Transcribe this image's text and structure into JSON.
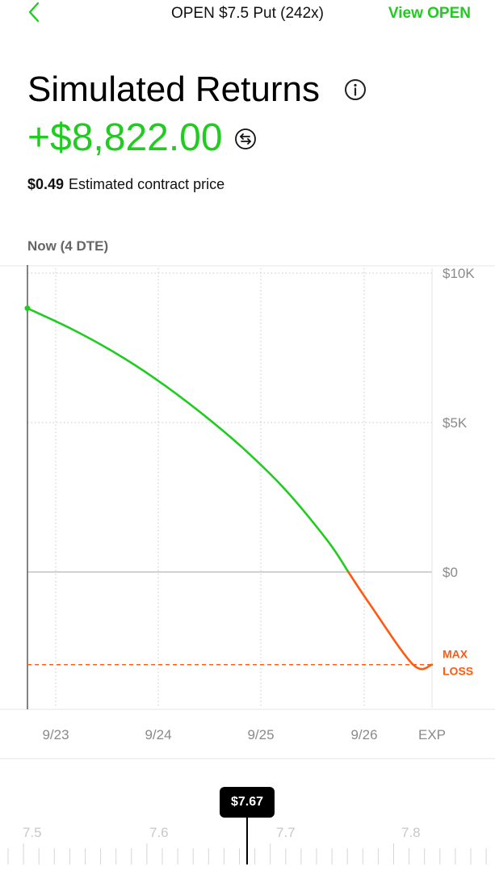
{
  "nav": {
    "title": "OPEN $7.5 Put (242x)",
    "action_label": "View OPEN",
    "accent": "#1fcc1f"
  },
  "header": {
    "title": "Simulated Returns",
    "return_value": "+$8,822.00",
    "contract_price": "$0.49",
    "contract_price_label": "Estimated contract price"
  },
  "chart_section": {
    "time_label": "Now (4 DTE)"
  },
  "chart_data": {
    "type": "line",
    "title": "",
    "xlabel": "",
    "ylabel": "",
    "x_ticks": [
      "9/23",
      "9/24",
      "9/25",
      "9/26",
      "EXP"
    ],
    "y_ticks": [
      "$10K",
      "$5K",
      "$0"
    ],
    "ylim": [
      -6300,
      10300
    ],
    "xlim": [
      0,
      4.5
    ],
    "grid": true,
    "series": [
      {
        "color": "#1fcc1f",
        "negative_color": "#ff5a0f",
        "points": [
          {
            "x": 0.0,
            "y": 8822
          },
          {
            "x": 0.5,
            "y": 8150
          },
          {
            "x": 1.0,
            "y": 7370
          },
          {
            "x": 1.5,
            "y": 6450
          },
          {
            "x": 2.0,
            "y": 5380
          },
          {
            "x": 2.5,
            "y": 4180
          },
          {
            "x": 3.0,
            "y": 2780
          },
          {
            "x": 3.5,
            "y": 1050
          },
          {
            "x": 4.0,
            "y": -1100
          },
          {
            "x": 4.5,
            "y": -3100
          },
          {
            "x": 4.72,
            "y": -3100
          }
        ]
      }
    ],
    "max_loss": {
      "value": -3100,
      "label_line1": "MAX",
      "label_line2": "LOSS",
      "color": "#ff5a0f"
    }
  },
  "slider": {
    "selected_value": "$7.67",
    "tick_labels": [
      "7.5",
      "7.6",
      "7.7",
      "7.8"
    ]
  }
}
